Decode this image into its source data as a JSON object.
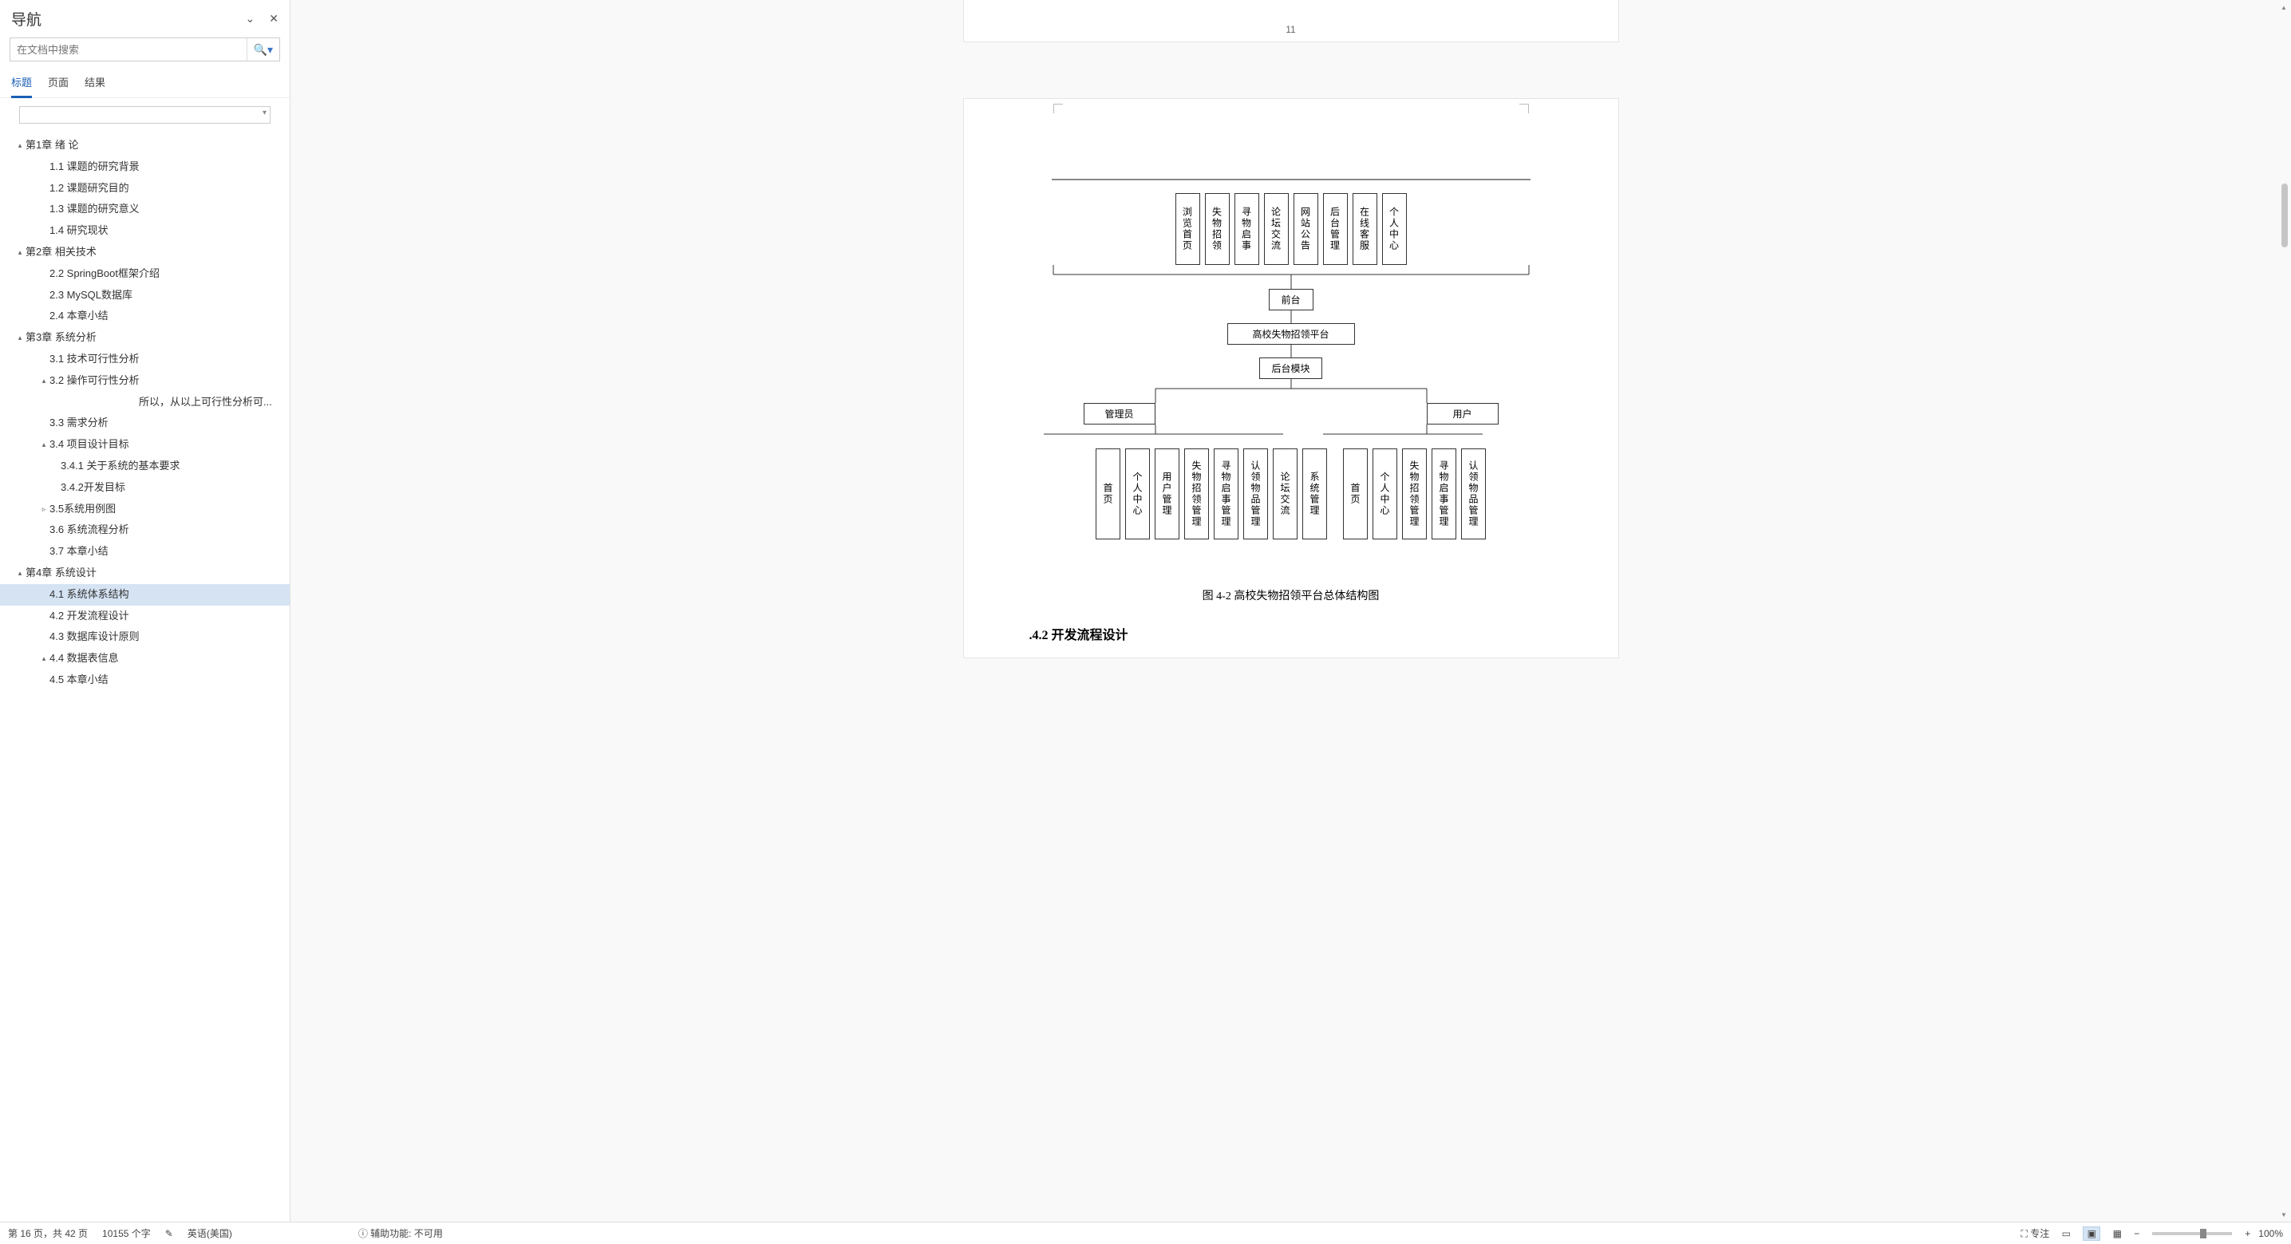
{
  "nav": {
    "title": "导航",
    "search_placeholder": "在文档中搜索",
    "tabs": {
      "headings": "标题",
      "pages": "页面",
      "results": "结果"
    }
  },
  "tree": [
    {
      "lvl": 0,
      "toggle": "▴",
      "label": "第1章  绪 论"
    },
    {
      "lvl": 1,
      "label": "1.1 课题的研究背景"
    },
    {
      "lvl": 1,
      "label": "1.2 课题研究目的"
    },
    {
      "lvl": 1,
      "label": "1.3 课题的研究意义"
    },
    {
      "lvl": 1,
      "label": "1.4 研究现状"
    },
    {
      "lvl": 0,
      "toggle": "▴",
      "label": "第2章  相关技术"
    },
    {
      "lvl": 1,
      "label": "2.2  SpringBoot框架介绍"
    },
    {
      "lvl": 1,
      "label": "2.3 MySQL数据库"
    },
    {
      "lvl": 1,
      "label": "2.4 本章小结"
    },
    {
      "lvl": 0,
      "toggle": "▴",
      "label": "第3章  系统分析"
    },
    {
      "lvl": 1,
      "label": "3.1 技术可行性分析"
    },
    {
      "lvl": 1,
      "toggle": "▴",
      "label": "3.2 操作可行性分析"
    },
    {
      "lvl": -1,
      "label": "所以，从以上可行性分析可..."
    },
    {
      "lvl": 1,
      "label": "3.3 需求分析"
    },
    {
      "lvl": 1,
      "toggle": "▴",
      "label": "3.4 项目设计目标"
    },
    {
      "lvl": 2,
      "label": "3.4.1 关于系统的基本要求"
    },
    {
      "lvl": 2,
      "label": "3.4.2开发目标"
    },
    {
      "lvl": 1,
      "toggle": "▹",
      "label": "3.5系统用例图"
    },
    {
      "lvl": 1,
      "label": "3.6 系统流程分析"
    },
    {
      "lvl": 1,
      "label": "3.7 本章小结"
    },
    {
      "lvl": 0,
      "toggle": "▴",
      "label": "第4章  系统设计"
    },
    {
      "lvl": 1,
      "label": "4.1 系统体系结构",
      "selected": true
    },
    {
      "lvl": 1,
      "label": "4.2 开发流程设计"
    },
    {
      "lvl": 1,
      "label": "4.3 数据库设计原则"
    },
    {
      "lvl": 1,
      "toggle": "▴",
      "label": "4.4 数据表信息"
    },
    {
      "lvl": 1,
      "label": "4.5 本章小结"
    }
  ],
  "doc": {
    "prev_page_num": "11",
    "diagram": {
      "top_row": [
        "浏览首页",
        "失物招领",
        "寻物启事",
        "论坛交流",
        "网站公告",
        "后台管理",
        "在线客服",
        "个人中心"
      ],
      "front": "前台",
      "platform": "高校失物招领平台",
      "backend": "后台模块",
      "admin": "管理员",
      "user": "用户",
      "admin_children": [
        "首页",
        "个人中心",
        "用户管理",
        "失物招领管理",
        "寻物启事管理",
        "认领物品管理",
        "论坛交流",
        "系统管理"
      ],
      "user_children": [
        "首页",
        "个人中心",
        "失物招领管理",
        "寻物启事管理",
        "认领物品管理"
      ]
    },
    "caption": "图 4-2 高校失物招领平台总体结构图",
    "next_section": "4.2  开发流程设计"
  },
  "status": {
    "page_info": "第 16 页，共 42 页",
    "word_count": "10155 个字",
    "lang": "英语(美国)",
    "accessibility": "辅助功能: 不可用",
    "focus": "专注",
    "zoom": "100%"
  }
}
